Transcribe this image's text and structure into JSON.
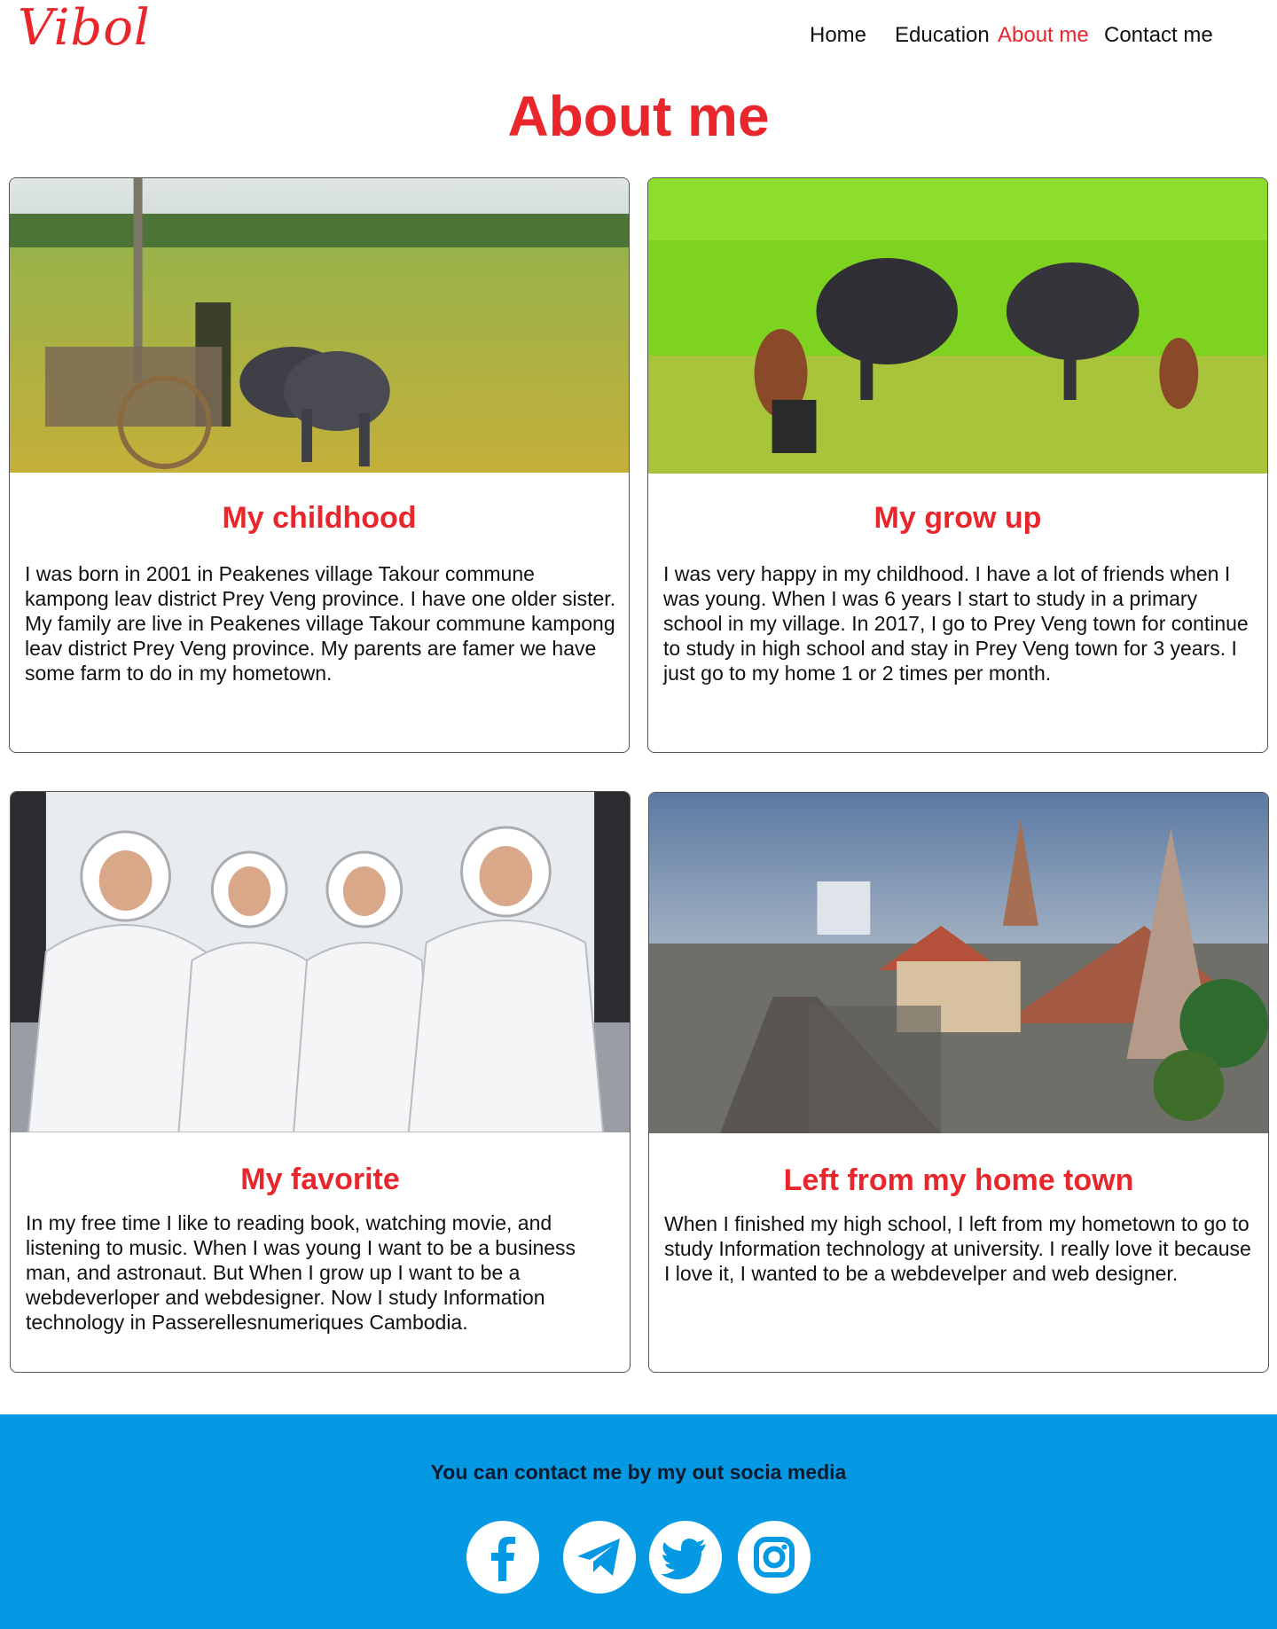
{
  "header": {
    "logo": "Vibol",
    "nav": [
      {
        "label": "Home"
      },
      {
        "label": "Education"
      },
      {
        "label": "About me",
        "active": true
      },
      {
        "label": "Contact me"
      }
    ]
  },
  "page": {
    "title": "About me"
  },
  "cards": [
    {
      "title": "My childhood",
      "text": "I was born in 2001 in Peakenes village Takour commune kampong leav district Prey Veng province. I have one older sister. My family are live in  Peakenes village Takour commune kampong leav district Prey Veng province. My parents are famer we have some farm to do in my hometown.",
      "image_alt": "Farmer with ox cart in rice field"
    },
    {
      "title": "My grow up",
      "text": "I was very happy in my childhood. I have a lot of friends when I was young. When I was 6 years I start to study in a primary school in my village. In 2017, I go to Prey Veng town for continue to study in high school and stay in Prey Veng town for 3 years. I just go to my home 1 or 2 times per month.",
      "image_alt": "Boys washing water buffaloes in a green paddy"
    },
    {
      "title": "My favorite",
      "text": "In my free time I like to reading book, watching movie, and listening to music. When I was young I want to be a business man, and astronaut. But When I grow up I want to be a webdeverloper and webdesigner. Now I study Information technology in Passerellesnumeriques Cambodia.",
      "image_alt": "Four astronauts in white spacesuits"
    },
    {
      "title": "Left from my home town",
      "text": "When I finished my high school, I left from my hometown to go to study Information technology at university. I really love it because I love it, I wanted to be a webdevelper and web designer.",
      "image_alt": "City street with temple at dusk"
    }
  ],
  "footer": {
    "text": "You can contact me by my out socia media",
    "social": [
      {
        "icon": "facebook-icon"
      },
      {
        "icon": "telegram-icon"
      },
      {
        "icon": "twitter-icon"
      },
      {
        "icon": "instagram-icon"
      }
    ]
  },
  "colors": {
    "accent": "#e8262b",
    "footer_bg": "#0599e4",
    "text": "#111111"
  }
}
